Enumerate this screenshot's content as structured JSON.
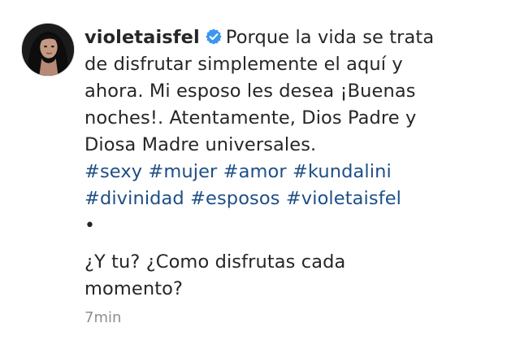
{
  "post": {
    "username": "violetaisfel",
    "verified_icon": "verified-badge-icon",
    "caption_lines": [
      "Porque la vida se trata",
      "de disfrutar simplemente el aquí y",
      "ahora. Mi esposo les desea ¡Buenas",
      "noches!. Atentamente, Dios Padre y",
      "Diosa Madre universales."
    ],
    "hashtags": [
      "#sexy",
      "#mujer",
      "#amor",
      "#kundalini",
      "#divinidad",
      "#esposos",
      "#violetaisfel"
    ],
    "bullet": "•",
    "question_lines": [
      "¿Y tu? ¿Como disfrutas cada",
      "momento?"
    ],
    "timestamp": "7min",
    "colors": {
      "hashtag": "#1e4f86",
      "text": "#262626",
      "timestamp": "#8e8e8e",
      "verified": "#3897f0"
    }
  }
}
